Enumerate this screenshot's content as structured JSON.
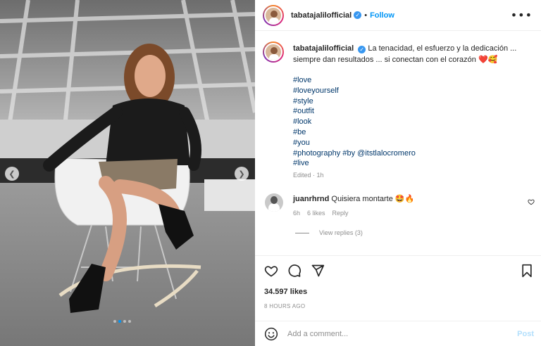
{
  "post": {
    "author": "tabatajalilofficial",
    "verified": true,
    "follow_label": "Follow",
    "separator": "•",
    "more_icon": "more-horizontal-icon"
  },
  "caption": {
    "username": "tabatajalilofficial",
    "text": "La tenacidad, el esfuerzo y la dedicación ... siempre dan resultados ... si conectan con el corazón",
    "emojis": "❤️🥰",
    "hashtags": [
      "#love",
      "#loveyourself",
      "#style",
      "#outfit",
      "#look",
      "#be",
      "#you"
    ],
    "photo_tag": "#photography",
    "by_tag": "#by",
    "mention": "@itstlalocromero",
    "last_tag": "#live",
    "edited": "Edited · 1h"
  },
  "comment": {
    "username": "juanrhrnd",
    "text": "Quisiera montarte",
    "emojis": "🤩🔥",
    "age": "6h",
    "likes": "6 likes",
    "reply_label": "Reply",
    "view_replies": "View replies (3)"
  },
  "actions": {
    "likes_count": "34.597 likes",
    "time_ago": "8 HOURS AGO"
  },
  "composer": {
    "placeholder": "Add a comment...",
    "post_label": "Post"
  },
  "carousel": {
    "slides": 4,
    "active_index": 1,
    "prev_icon": "chevron-left-icon",
    "next_icon": "chevron-right-icon"
  },
  "colors": {
    "accent": "#0095f6",
    "link": "#00376b",
    "muted": "#8e8e8e",
    "post_disabled": "#b2dffc"
  }
}
